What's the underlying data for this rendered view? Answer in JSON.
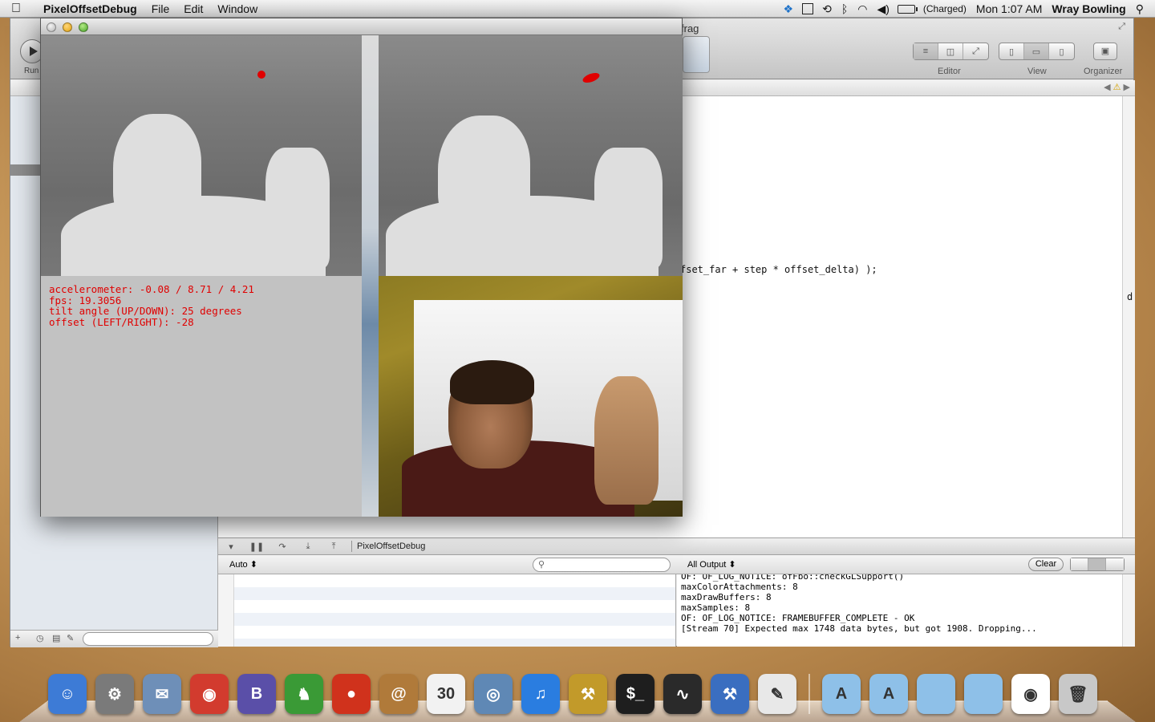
{
  "menubar": {
    "app_name": "PixelOffsetDebug",
    "menus": [
      "File",
      "Edit",
      "Window"
    ],
    "battery_status": "(Charged)",
    "clock": "Mon 1:07 AM",
    "user": "Wray Bowling"
  },
  "xcode": {
    "title_partial": "frag",
    "run_label": "Run",
    "toolbar_labels": {
      "editor": "Editor",
      "view": "View",
      "organizer": "Organizer"
    },
    "code_fragment": "fset_far + step * offset_delta) );",
    "debug_bar": {
      "target": "PixelOffsetDebug"
    },
    "filter_bar": {
      "auto": "Auto",
      "all_output": "All Output",
      "clear": "Clear"
    },
    "console_lines": [
      "OF: OF_LOG_NOTICE: ofFbo::checkGLSupport()",
      "maxColorAttachments: 8",
      "maxDrawBuffers: 8",
      "maxSamples: 8",
      "OF: OF_LOG_NOTICE: FRAMEBUFFER_COMPLETE - OK",
      "[Stream 70] Expected max 1748 data bytes, but got 1908. Dropping..."
    ],
    "right_edge_char": "d"
  },
  "of_window": {
    "hud": {
      "accelerometer": "accelerometer: -0.08 / 8.71 / 4.21",
      "fps": "fps: 19.3056",
      "tilt": "tilt angle (UP/DOWN): 25 degrees",
      "offset": "offset (LEFT/RIGHT): -28"
    }
  },
  "dock": {
    "items": [
      {
        "icon": "finder-icon",
        "color": "#3d7bd6",
        "glyph": "☺"
      },
      {
        "icon": "system-preferences-icon",
        "color": "#7a7a7a",
        "glyph": "⚙"
      },
      {
        "icon": "mail-stamp-icon",
        "color": "#6e8fb8",
        "glyph": "✉"
      },
      {
        "icon": "chrome-icon",
        "color": "#d23b2e",
        "glyph": "◉"
      },
      {
        "icon": "bbedit-icon",
        "color": "#5a4fa8",
        "glyph": "B"
      },
      {
        "icon": "cyberduck-icon",
        "color": "#3a9a36",
        "glyph": "♞"
      },
      {
        "icon": "tomato-timer-icon",
        "color": "#d0321c",
        "glyph": "●"
      },
      {
        "icon": "address-book-icon",
        "color": "#b07a3a",
        "glyph": "@"
      },
      {
        "icon": "calendar-icon",
        "color": "#f2f2f2",
        "glyph": "30"
      },
      {
        "icon": "preview-icon",
        "color": "#5f88b5",
        "glyph": "◎"
      },
      {
        "icon": "itunes-icon",
        "color": "#2a7de0",
        "glyph": "♫"
      },
      {
        "icon": "archive-utility-icon",
        "color": "#c29a2a",
        "glyph": "⚒"
      },
      {
        "icon": "terminal-icon",
        "color": "#1e1e1e",
        "glyph": "$_"
      },
      {
        "icon": "activity-monitor-icon",
        "color": "#2a2a2a",
        "glyph": "∿"
      },
      {
        "icon": "xcode-icon",
        "color": "#3a6ec0",
        "glyph": "⚒"
      },
      {
        "icon": "instruments-icon",
        "color": "#e8e8e8",
        "glyph": "✎"
      }
    ],
    "stacks": [
      {
        "icon": "applications-folder-icon",
        "color": "#8ec0e8",
        "glyph": "A"
      },
      {
        "icon": "utilities-folder-icon",
        "color": "#8ec0e8",
        "glyph": "A"
      },
      {
        "icon": "documents-folder-icon",
        "color": "#8ec0e8",
        "glyph": ""
      },
      {
        "icon": "downloads-folder-icon",
        "color": "#8ec0e8",
        "glyph": ""
      },
      {
        "icon": "chrome-window-icon",
        "color": "#ffffff",
        "glyph": "◉"
      },
      {
        "icon": "trash-icon",
        "color": "#c8c8c8",
        "glyph": "🗑"
      }
    ]
  }
}
